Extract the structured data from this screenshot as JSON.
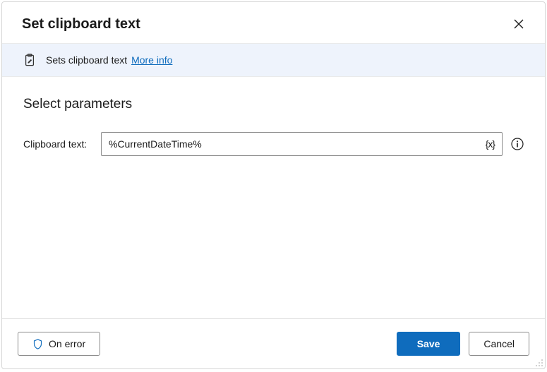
{
  "header": {
    "title": "Set clipboard text"
  },
  "banner": {
    "description": "Sets clipboard text",
    "more_info_label": "More info"
  },
  "parameters": {
    "section_title": "Select parameters",
    "clipboard_text_label": "Clipboard text:",
    "clipboard_text_value": "%CurrentDateTime%",
    "variable_icon": "{x}"
  },
  "footer": {
    "on_error_label": "On error",
    "save_label": "Save",
    "cancel_label": "Cancel"
  }
}
